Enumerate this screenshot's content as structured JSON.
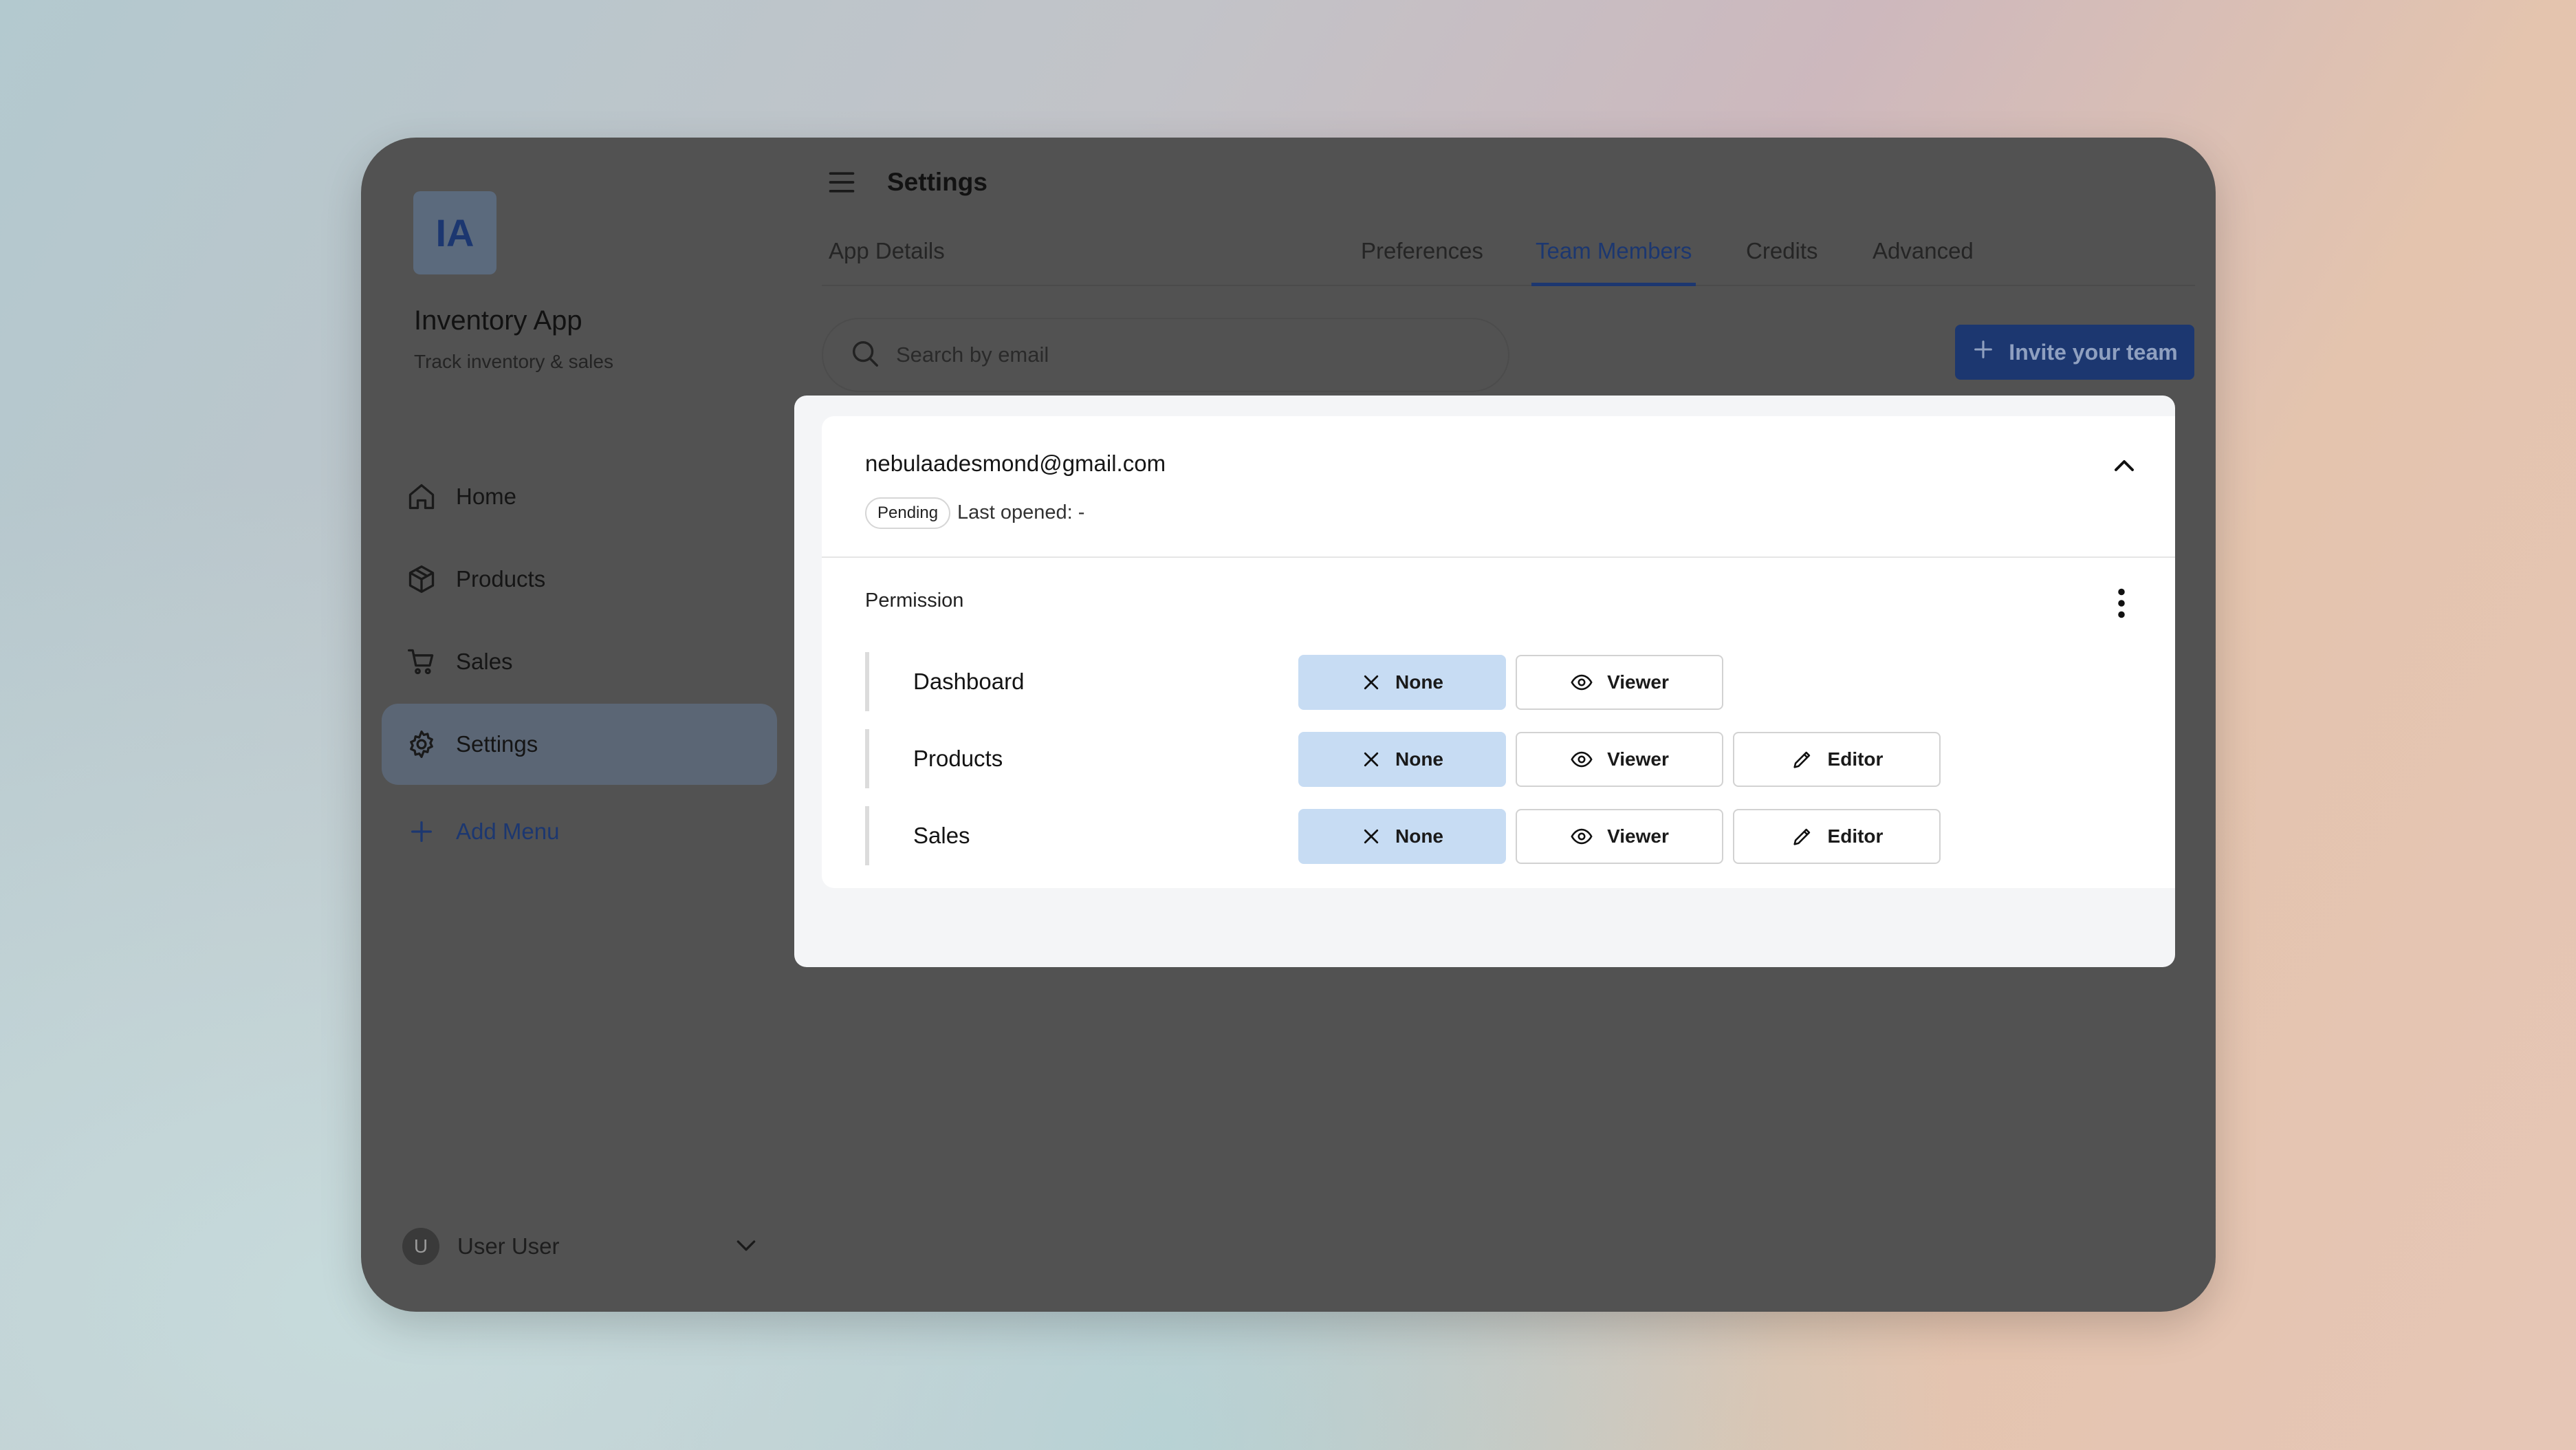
{
  "app": {
    "logo_initials": "IA",
    "title": "Inventory App",
    "subtitle": "Track inventory & sales"
  },
  "sidebar": {
    "items": [
      {
        "label": "Home",
        "icon": "home-icon"
      },
      {
        "label": "Products",
        "icon": "box-icon"
      },
      {
        "label": "Sales",
        "icon": "cart-icon"
      },
      {
        "label": "Settings",
        "icon": "gear-icon",
        "active": true
      }
    ],
    "add_menu_label": "Add Menu"
  },
  "user": {
    "initial": "U",
    "name": "User User"
  },
  "header": {
    "title": "Settings"
  },
  "tabs": [
    {
      "label": "App Details"
    },
    {
      "label": "Preferences"
    },
    {
      "label": "Team Members",
      "active": true
    },
    {
      "label": "Credits"
    },
    {
      "label": "Advanced"
    }
  ],
  "search": {
    "placeholder": "Search by email"
  },
  "invite_button": {
    "label": "Invite your team"
  },
  "member": {
    "email": "nebulaadesmond@gmail.com",
    "status": "Pending",
    "last_opened": "Last opened: -",
    "permission_label": "Permission",
    "permissions": [
      {
        "name": "Dashboard",
        "selected": "None",
        "options": [
          "None",
          "Viewer"
        ]
      },
      {
        "name": "Products",
        "selected": "None",
        "options": [
          "None",
          "Viewer",
          "Editor"
        ]
      },
      {
        "name": "Sales",
        "selected": "None",
        "options": [
          "None",
          "Viewer",
          "Editor"
        ]
      }
    ]
  },
  "colors": {
    "accent": "#1c3770",
    "selected_option": "#c7dcf3",
    "overlay": "#525252"
  }
}
